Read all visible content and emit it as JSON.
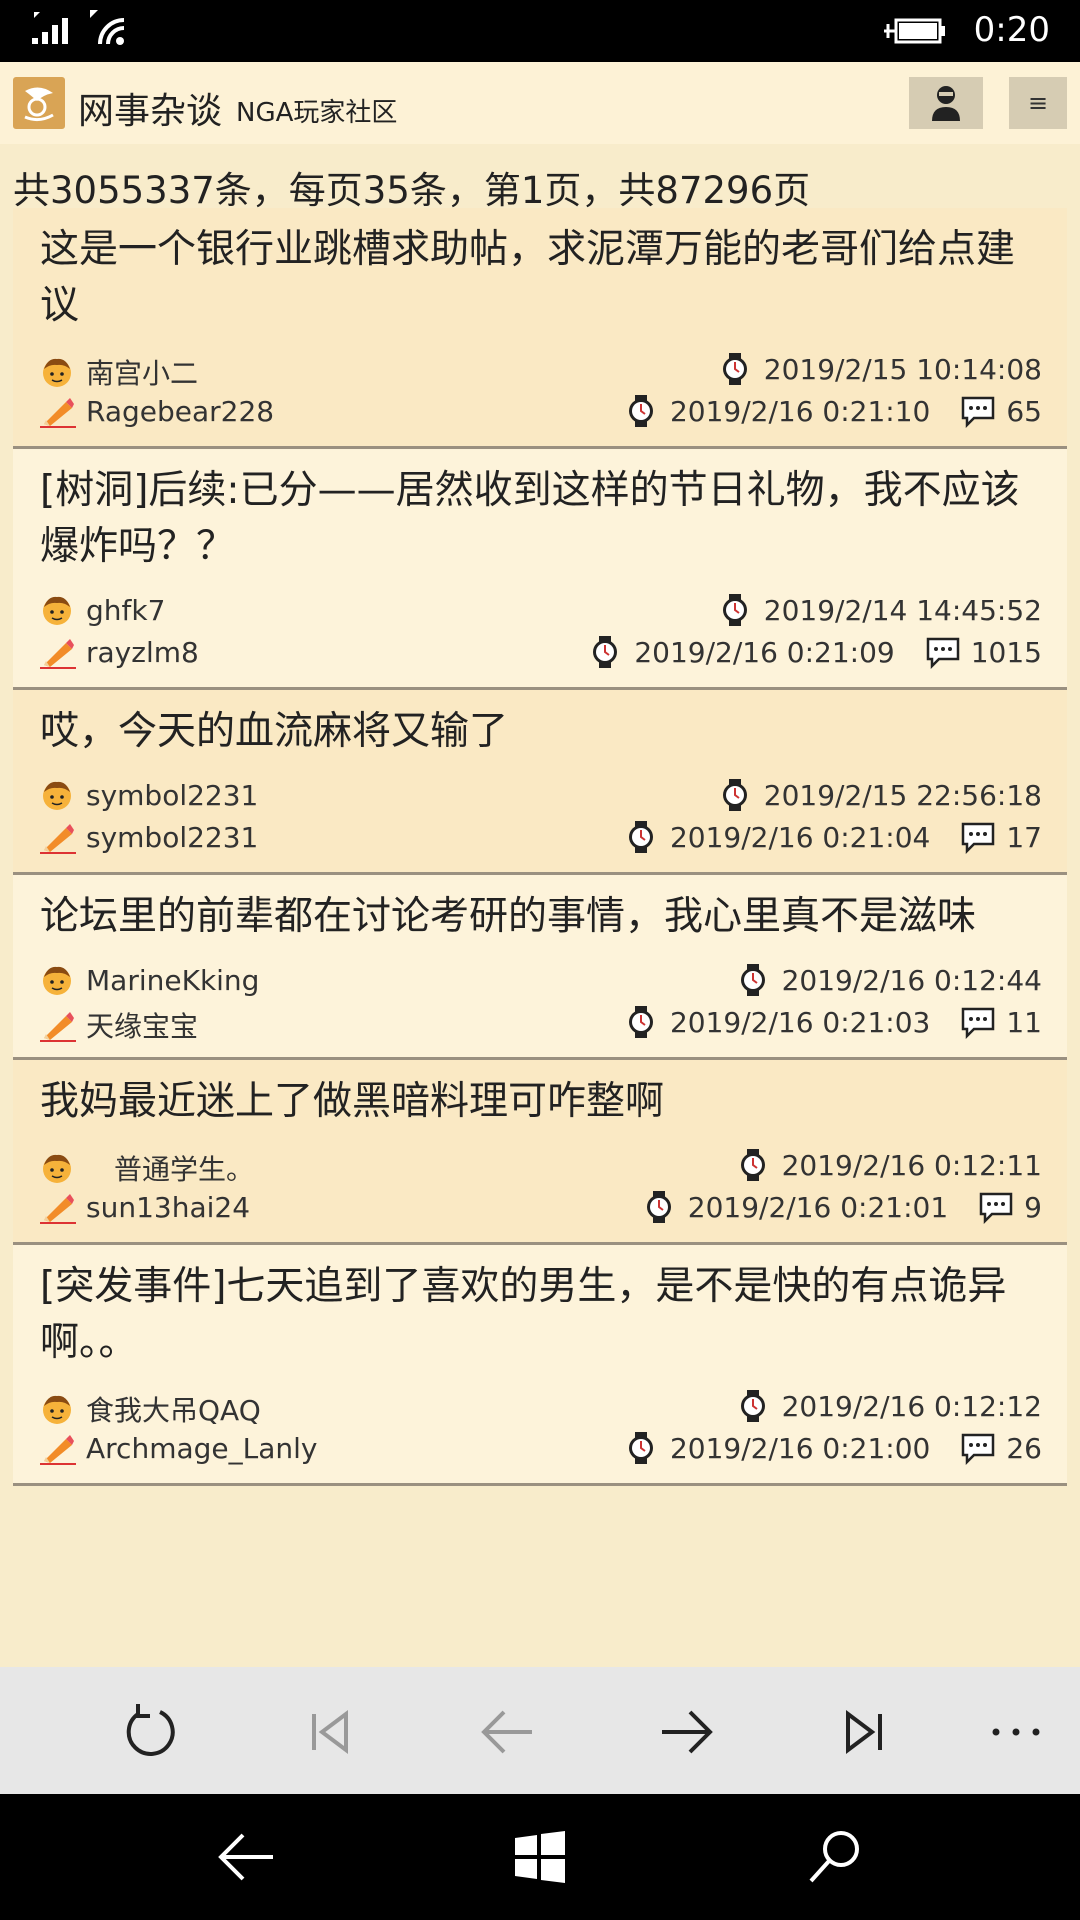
{
  "status": {
    "time": "0:20"
  },
  "header": {
    "title": "网事杂谈",
    "subtitle": "NGA玩家社区",
    "menu_glyph": "≡"
  },
  "page_info": "共3055337条，每页35条，第1页，共87296页",
  "threads": [
    {
      "title": "这是一个银行业跳槽求助帖，求泥潭万能的老哥们给点建议",
      "author": "南宫小二",
      "post_time": "2019/2/15 10:14:08",
      "last_replier": "Ragebear228",
      "last_time": "2019/2/16 0:21:10",
      "replies": "65"
    },
    {
      "title": "[树洞]后续:已分——居然收到这样的节日礼物，我不应该爆炸吗？？",
      "author": "ghfk7",
      "post_time": "2019/2/14 14:45:52",
      "last_replier": "rayzlm8",
      "last_time": "2019/2/16 0:21:09",
      "replies": "1015"
    },
    {
      "title": "哎，今天的血流麻将又输了",
      "author": "symbol2231",
      "post_time": "2019/2/15 22:56:18",
      "last_replier": "symbol2231",
      "last_time": "2019/2/16 0:21:04",
      "replies": "17"
    },
    {
      "title": "论坛里的前辈都在讨论考研的事情，我心里真不是滋味",
      "author": "MarineKking",
      "post_time": "2019/2/16 0:12:44",
      "last_replier": "天缘宝宝",
      "last_time": "2019/2/16 0:21:03",
      "replies": "11"
    },
    {
      "title": "我妈最近迷上了做黑暗料理可咋整啊",
      "author": "　普通学生。",
      "post_time": "2019/2/16 0:12:11",
      "last_replier": "sun13hai24",
      "last_time": "2019/2/16 0:21:01",
      "replies": "9"
    },
    {
      "title": "[突发事件]七天追到了喜欢的男生，是不是快的有点诡异啊。。",
      "author": "食我大吊QAQ",
      "post_time": "2019/2/16 0:12:12",
      "last_replier": "Archmage_Lanly",
      "last_time": "2019/2/16 0:21:00",
      "replies": "26"
    }
  ],
  "icons": {
    "author": "boy-face-icon",
    "replier": "pencil-icon",
    "time": "watch-icon",
    "replies": "comment-icon"
  },
  "appbar": [
    "refresh-icon",
    "first-page-icon",
    "previous-page-icon",
    "next-page-icon",
    "last-page-icon",
    "more-icon"
  ],
  "navbar": [
    "back-icon",
    "windows-start-icon",
    "search-icon"
  ]
}
